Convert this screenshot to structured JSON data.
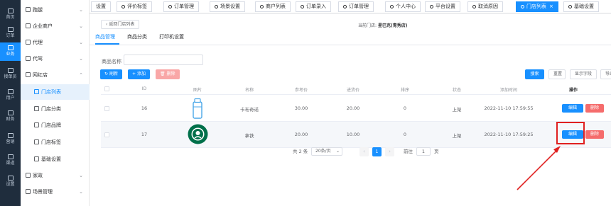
{
  "rail": [
    {
      "label": "首页",
      "icon": "home-icon"
    },
    {
      "label": "订单",
      "icon": "order-icon"
    },
    {
      "label": "业务",
      "icon": "business-icon",
      "active": true
    },
    {
      "label": "接单员",
      "icon": "delivery-icon"
    },
    {
      "label": "用户",
      "icon": "user-icon"
    },
    {
      "label": "财务",
      "icon": "finance-icon"
    },
    {
      "label": "营销",
      "icon": "marketing-icon"
    },
    {
      "label": "渠道",
      "icon": "channel-icon"
    },
    {
      "label": "设置",
      "icon": "settings-icon"
    }
  ],
  "submenu": {
    "items": [
      {
        "label": "跑腿",
        "arrow": "⌄"
      },
      {
        "label": "企业商户",
        "arrow": "⌄"
      },
      {
        "label": "代理",
        "arrow": "⌄"
      },
      {
        "label": "代驾",
        "arrow": "⌄"
      },
      {
        "label": "网红店",
        "arrow": "⌃"
      }
    ],
    "children": [
      {
        "label": "门店列表",
        "active": true
      },
      {
        "label": "门店分类"
      },
      {
        "label": "门店品牌"
      },
      {
        "label": "门店标签"
      },
      {
        "label": "基础设置"
      }
    ],
    "tail": [
      {
        "label": "家政",
        "arrow": "⌄"
      },
      {
        "label": "场景管理",
        "arrow": "⌄"
      }
    ]
  },
  "tabs": [
    "设置",
    "评价标签",
    "订单管理",
    "场景设置",
    "商户列表",
    "订单录入",
    "订单管理",
    "个人中心",
    "平台设置",
    "取消原因",
    "门店列表",
    "基础设置"
  ],
  "active_tab_close": "×",
  "back_button": "返回门店列表",
  "store": {
    "prefix": "当前门店:",
    "name": "星巴克(青秀店)"
  },
  "subtabs": [
    "商品管理",
    "商品分类",
    "打印机设置"
  ],
  "filter": {
    "label": "商品名称",
    "value": ""
  },
  "toolbar": {
    "refresh": "刷新",
    "add": "添加",
    "delete": "删除"
  },
  "right_toolbar": {
    "search": "搜索",
    "reset": "重置",
    "columns": "显示字段",
    "export": "导出"
  },
  "table": {
    "headers": [
      "ID",
      "图片",
      "名称",
      "参考价",
      "进货价",
      "排序",
      "状态",
      "添加时间",
      "操作"
    ],
    "rows": [
      {
        "id": "16",
        "image": "cup-icon",
        "name": "卡布奇诺",
        "ref_price": "30.00",
        "cost_price": "20.00",
        "sort": "0",
        "status": "上架",
        "time": "2022-11-10 17:59:55"
      },
      {
        "id": "17",
        "image": "starbucks-logo",
        "name": "拿铁",
        "ref_price": "20.00",
        "cost_price": "10.00",
        "sort": "0",
        "status": "上架",
        "time": "2022-11-10 17:59:25"
      }
    ],
    "edit_label": "编辑",
    "delete_label": "删除"
  },
  "pagination": {
    "total": "共 2 条",
    "page_size": "20条/页",
    "current": "1",
    "goto_prefix": "前往",
    "goto_value": "1",
    "goto_suffix": "页",
    "prev": "‹",
    "next": "›"
  },
  "colors": {
    "primary": "#1890ff",
    "danger": "#f56c6c",
    "rail": "#1f2d3d",
    "annotation": "#e02020"
  }
}
